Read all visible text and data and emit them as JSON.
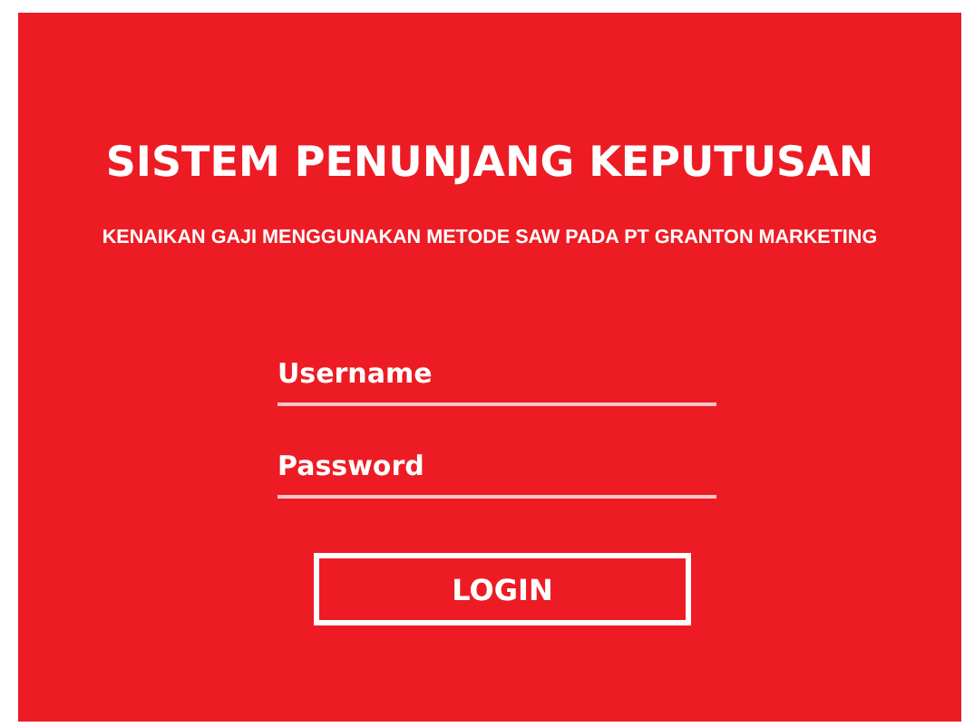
{
  "title": "SISTEM PENUNJANG KEPUTUSAN",
  "subtitle": "KENAIKAN GAJI MENGGUNAKAN METODE SAW PADA PT GRANTON MARKETING",
  "fields": [
    {
      "placeholder": "Username"
    },
    {
      "placeholder": "Password"
    }
  ],
  "button": "LOGIN"
}
